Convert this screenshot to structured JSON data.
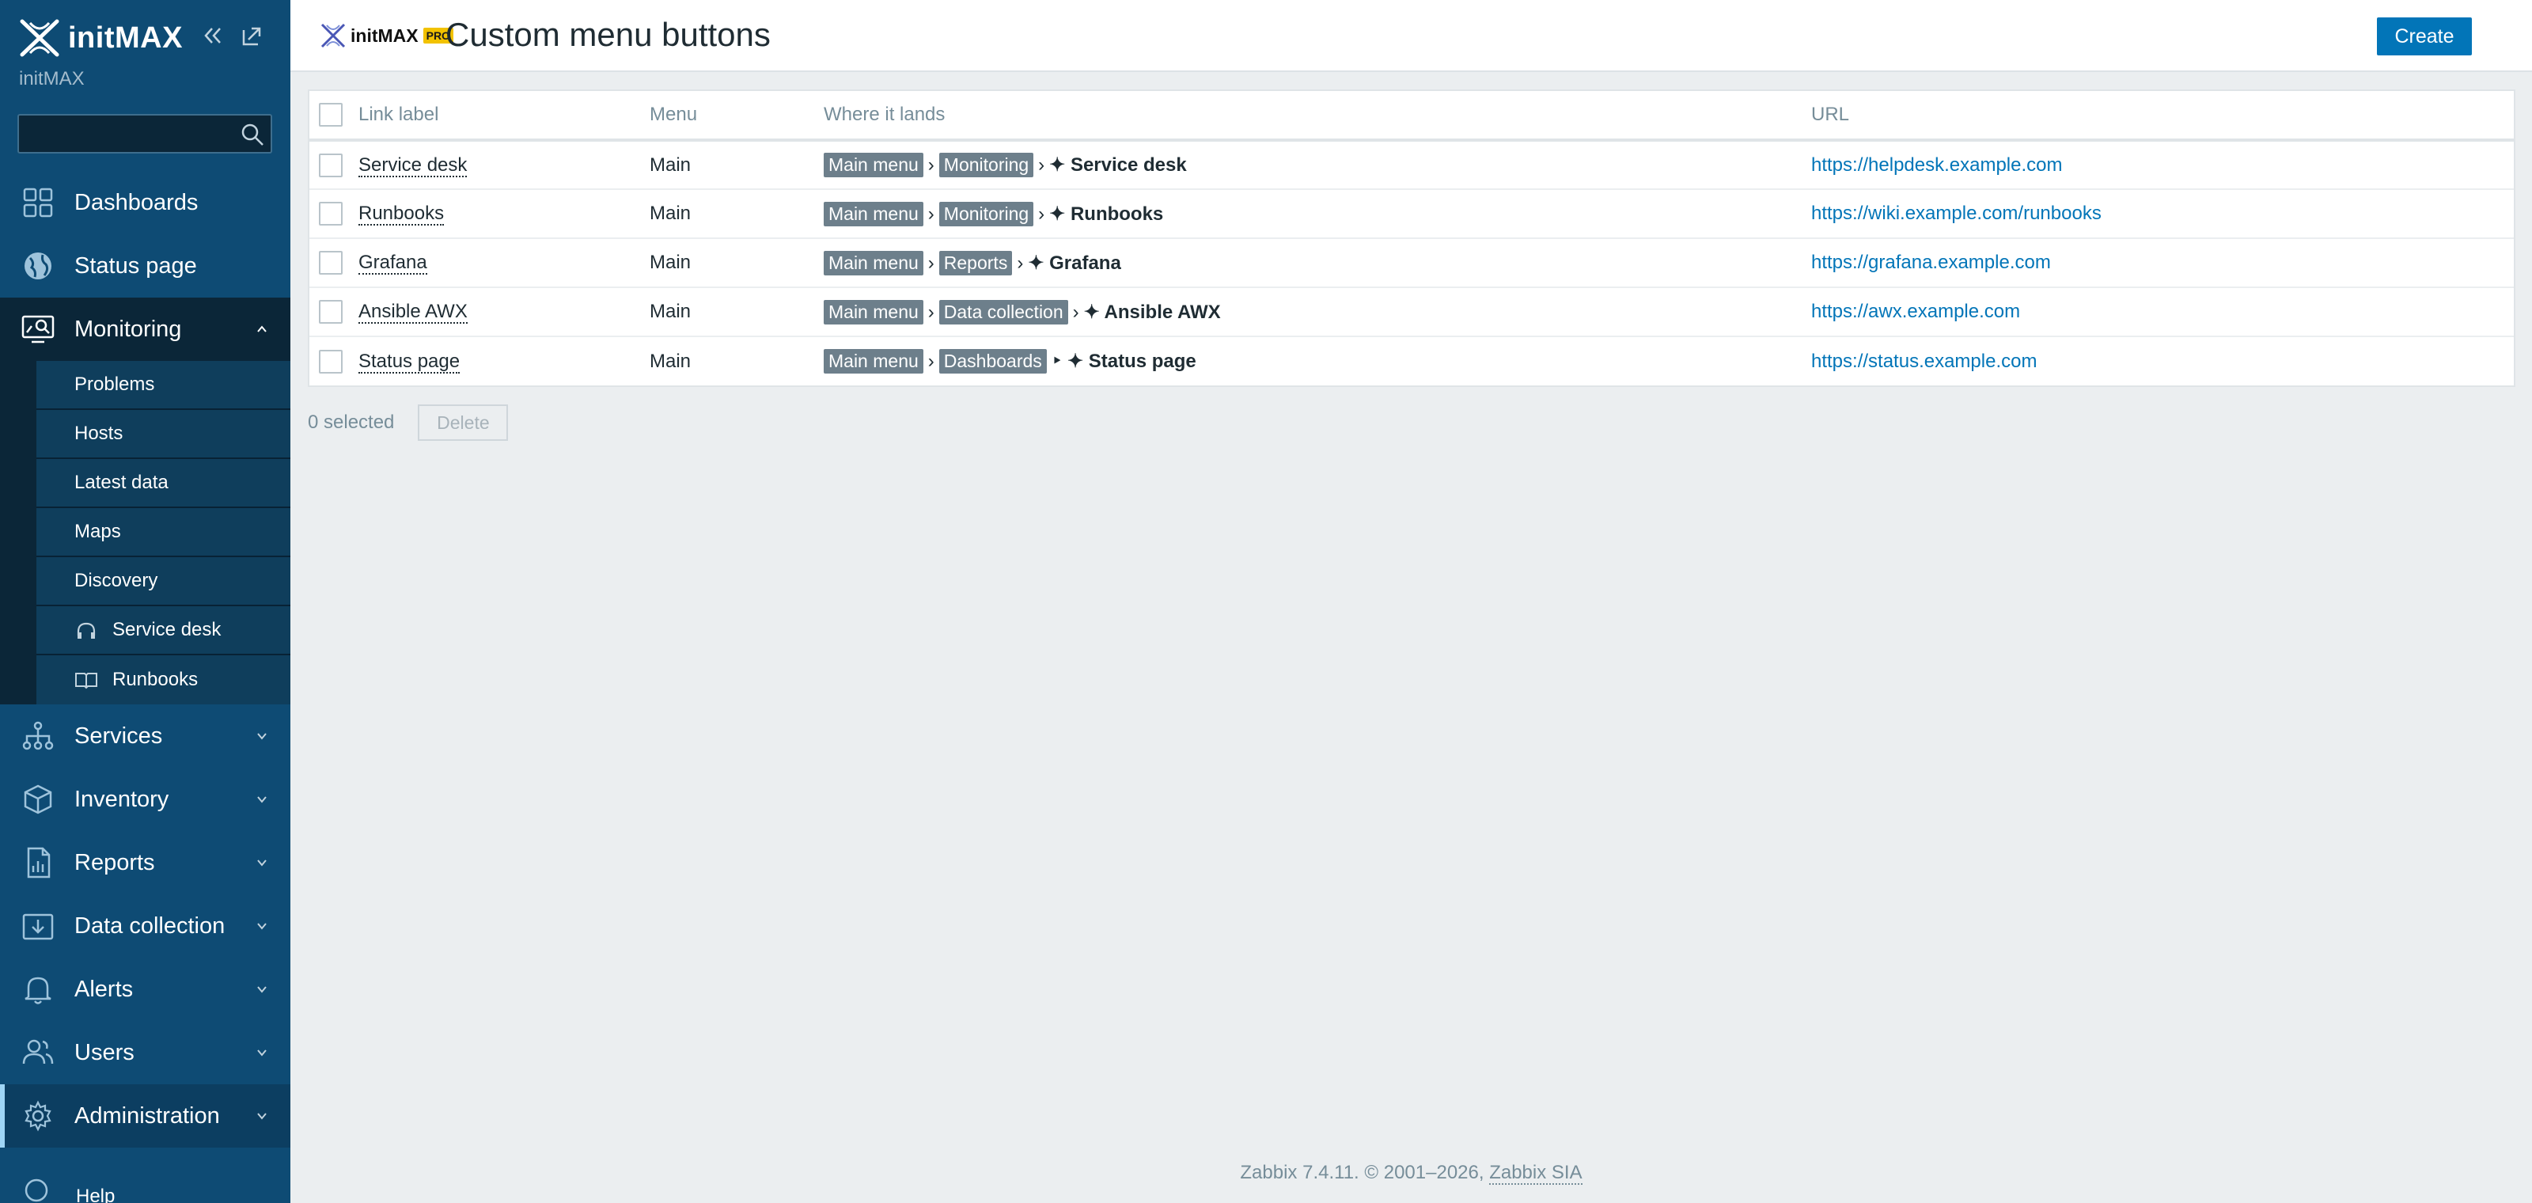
{
  "sidebar": {
    "brand": "initMAX",
    "subtitle": "initMAX",
    "search": {
      "value": "",
      "placeholder": ""
    },
    "nav": [
      {
        "label": "Dashboards",
        "icon": "dashboards-icon"
      },
      {
        "label": "Status page",
        "icon": "globe-icon"
      },
      {
        "label": "Monitoring",
        "icon": "monitoring-icon",
        "expanded": true
      },
      {
        "label": "Services",
        "icon": "services-icon"
      },
      {
        "label": "Inventory",
        "icon": "inventory-icon"
      },
      {
        "label": "Reports",
        "icon": "reports-icon"
      },
      {
        "label": "Data collection",
        "icon": "data-collection-icon"
      },
      {
        "label": "Alerts",
        "icon": "bell-icon"
      },
      {
        "label": "Users",
        "icon": "users-icon"
      },
      {
        "label": "Administration",
        "icon": "gear-icon"
      }
    ],
    "monitoring_sub": [
      {
        "label": "Problems"
      },
      {
        "label": "Hosts"
      },
      {
        "label": "Latest data"
      },
      {
        "label": "Maps"
      },
      {
        "label": "Discovery"
      },
      {
        "label": "Service desk",
        "icon": "headset-icon"
      },
      {
        "label": "Runbooks",
        "icon": "book-icon"
      }
    ],
    "help": "Help"
  },
  "header": {
    "logo_text": "initMAX",
    "pro_badge": "PRO",
    "title": "Custom menu buttons",
    "create_label": "Create"
  },
  "table": {
    "columns": [
      "Link label",
      "Menu",
      "Where it lands",
      "URL"
    ],
    "rows": [
      {
        "label": "Service desk",
        "menu": "Main",
        "path": [
          "Main menu",
          "Monitoring"
        ],
        "last_sep": "›",
        "dest": "✦ Service desk",
        "url": "https://helpdesk.example.com"
      },
      {
        "label": "Runbooks",
        "menu": "Main",
        "path": [
          "Main menu",
          "Monitoring"
        ],
        "last_sep": "›",
        "dest": "✦ Runbooks",
        "url": "https://wiki.example.com/runbooks"
      },
      {
        "label": "Grafana",
        "menu": "Main",
        "path": [
          "Main menu",
          "Reports"
        ],
        "last_sep": "›",
        "dest": "✦ Grafana",
        "url": "https://grafana.example.com"
      },
      {
        "label": "Ansible AWX",
        "menu": "Main",
        "path": [
          "Main menu",
          "Data collection"
        ],
        "last_sep": "›",
        "dest": "✦ Ansible AWX",
        "url": "https://awx.example.com"
      },
      {
        "label": "Status page",
        "menu": "Main",
        "path": [
          "Main menu",
          "Dashboards"
        ],
        "last_sep": "‣",
        "dest": "✦ Status page",
        "url": "https://status.example.com"
      }
    ],
    "path_sep": "›"
  },
  "selection": {
    "count_text": "0 selected",
    "delete_label": "Delete"
  },
  "footer": {
    "text": "Zabbix 7.4.11. © 2001–2026,",
    "link": "Zabbix SIA"
  },
  "colors": {
    "sidebar": "#0e4b74",
    "accent": "#0275b8",
    "tag": "#6d7f8b",
    "pro": "#f2c200"
  }
}
